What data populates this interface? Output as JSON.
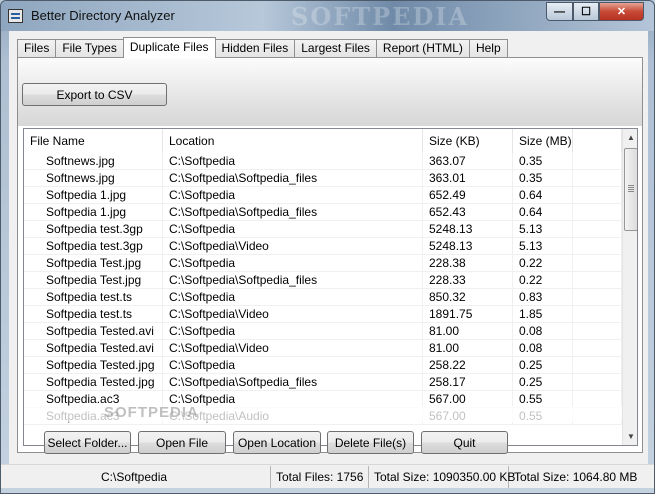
{
  "window": {
    "title": "Better Directory Analyzer",
    "watermark": "SOFTPEDIA",
    "minimize_label": "—",
    "maximize_label": "☐",
    "close_label": "✕"
  },
  "tabs": [
    "Files",
    "File Types",
    "Duplicate Files",
    "Hidden Files",
    "Largest Files",
    "Report (HTML)",
    "Help"
  ],
  "active_tab": "Duplicate Files",
  "toolbar": {
    "export_label": "Export to CSV"
  },
  "table": {
    "columns": [
      "File Name",
      "Location",
      "Size (KB)",
      "Size (MB)",
      ""
    ],
    "rows": [
      [
        "Softnews.jpg",
        "C:\\Softpedia",
        "363.07",
        "0.35"
      ],
      [
        "Softnews.jpg",
        "C:\\Softpedia\\Softpedia_files",
        "363.01",
        "0.35"
      ],
      [
        "Softpedia 1.jpg",
        "C:\\Softpedia",
        "652.49",
        "0.64"
      ],
      [
        "Softpedia 1.jpg",
        "C:\\Softpedia\\Softpedia_files",
        "652.43",
        "0.64"
      ],
      [
        "Softpedia test.3gp",
        "C:\\Softpedia",
        "5248.13",
        "5.13"
      ],
      [
        "Softpedia test.3gp",
        "C:\\Softpedia\\Video",
        "5248.13",
        "5.13"
      ],
      [
        "Softpedia Test.jpg",
        "C:\\Softpedia",
        "228.38",
        "0.22"
      ],
      [
        "Softpedia Test.jpg",
        "C:\\Softpedia\\Softpedia_files",
        "228.33",
        "0.22"
      ],
      [
        "Softpedia test.ts",
        "C:\\Softpedia",
        "850.32",
        "0.83"
      ],
      [
        "Softpedia test.ts",
        "C:\\Softpedia\\Video",
        "1891.75",
        "1.85"
      ],
      [
        "Softpedia Tested.avi",
        "C:\\Softpedia",
        "81.00",
        "0.08"
      ],
      [
        "Softpedia Tested.avi",
        "C:\\Softpedia\\Video",
        "81.00",
        "0.08"
      ],
      [
        "Softpedia Tested.jpg",
        "C:\\Softpedia",
        "258.22",
        "0.25"
      ],
      [
        "Softpedia Tested.jpg",
        "C:\\Softpedia\\Softpedia_files",
        "258.17",
        "0.25"
      ],
      [
        "Softpedia.ac3",
        "C:\\Softpedia",
        "567.00",
        "0.55"
      ],
      [
        "Softpedia.ac3",
        "C:\\Softpedia\\Audio",
        "567.00",
        "0.55"
      ]
    ],
    "watermark": "SOFTPEDIA"
  },
  "buttons": {
    "select_folder": "Select Folder...",
    "open_file": "Open File",
    "open_location": "Open Location",
    "delete_files": "Delete File(s)",
    "quit": "Quit"
  },
  "status": {
    "path": "C:\\Softpedia",
    "total_files": "Total Files: 1756",
    "total_kb": "Total Size: 1090350.00 KB",
    "total_mb": "Total Size: 1064.80 MB"
  }
}
